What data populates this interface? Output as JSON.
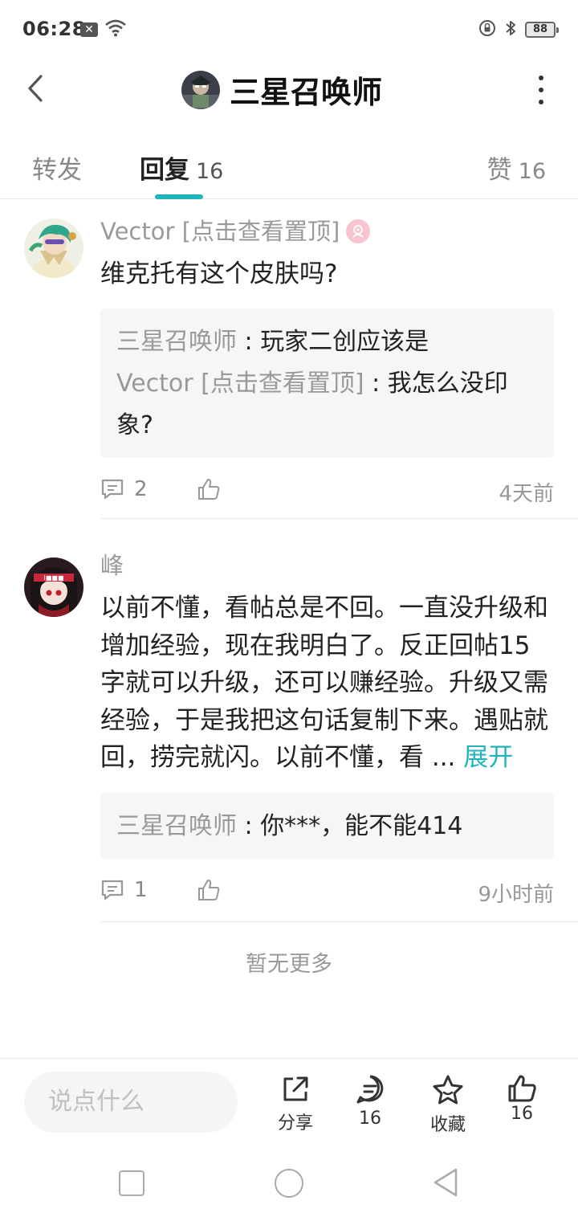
{
  "status": {
    "time": "06:28",
    "x_badge": "✕",
    "battery": "88"
  },
  "header": {
    "title": "三星召唤师"
  },
  "tabs": {
    "forward_label": "转发",
    "reply_label": "回复",
    "reply_count": "16",
    "like_label": "赞",
    "like_count": "16"
  },
  "comments": [
    {
      "author": "Vector [点击查看置顶]",
      "text": "维克托有这个皮肤吗?",
      "replies": [
        {
          "name": "三星召唤师",
          "sep": " : ",
          "text": "玩家二创应该是"
        },
        {
          "name": "Vector [点击查看置顶]",
          "sep": " : ",
          "text": "我怎么没印象?"
        }
      ],
      "reply_count": "2",
      "time": "4天前"
    },
    {
      "author": "峰",
      "text": "以前不懂，看帖总是不回。一直没升级和增加经验，现在我明白了。反正回帖15字就可以升级，还可以赚经验。升级又需经验，于是我把这句话复制下来。遇贴就回，捞完就闪。以前不懂，看 ...",
      "expand": "展开",
      "replies": [
        {
          "name": "三星召唤师",
          "sep": " : ",
          "text": "你***，能不能414"
        }
      ],
      "reply_count": "1",
      "time": "9小时前"
    }
  ],
  "footer_text": "暂无更多",
  "bottom_bar": {
    "input_placeholder": "说点什么",
    "share_label": "分享",
    "comment_count": "16",
    "favorite_label": "收藏",
    "like_count": "16"
  },
  "colors": {
    "accent": "#1fb5bd",
    "muted_text": "#999999",
    "reply_bg": "#f6f6f6"
  }
}
